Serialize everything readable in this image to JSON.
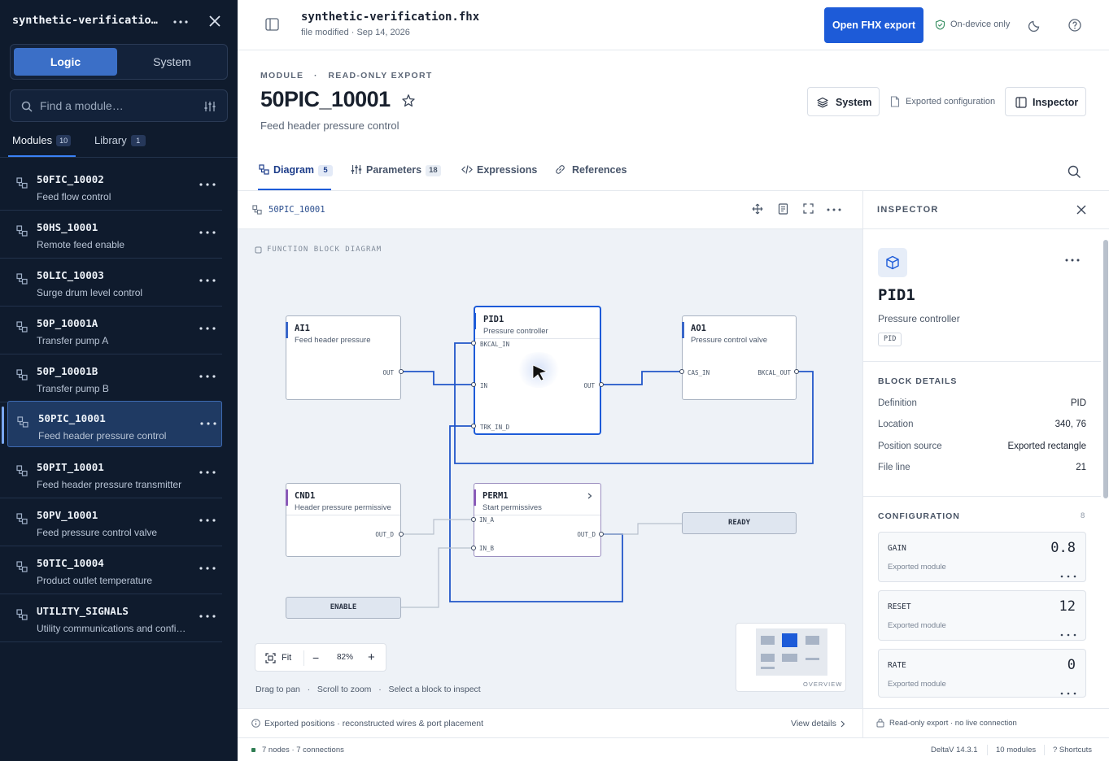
{
  "sidebar": {
    "title": "synthetic-verification.fhx",
    "segments": {
      "logic": "Logic",
      "system": "System"
    },
    "search_placeholder": "Find a module…",
    "tabs": {
      "modules": "Modules",
      "modules_count": "10",
      "library": "Library",
      "library_count": "1"
    },
    "modules": [
      {
        "name": "50FIC_10002",
        "desc": "Feed flow control"
      },
      {
        "name": "50HS_10001",
        "desc": "Remote feed enable"
      },
      {
        "name": "50LIC_10003",
        "desc": "Surge drum level control"
      },
      {
        "name": "50P_10001A",
        "desc": "Transfer pump A"
      },
      {
        "name": "50P_10001B",
        "desc": "Transfer pump B"
      },
      {
        "name": "50PIC_10001",
        "desc": "Feed header pressure control",
        "selected": true
      },
      {
        "name": "50PIT_10001",
        "desc": "Feed header pressure transmitter"
      },
      {
        "name": "50PV_10001",
        "desc": "Feed pressure control valve"
      },
      {
        "name": "50TIC_10004",
        "desc": "Product outlet temperature"
      },
      {
        "name": "UTILITY_SIGNALS",
        "desc": "Utility communications and configuration"
      }
    ]
  },
  "topbar": {
    "file": "synthetic-verification.fhx",
    "modified": "file modified · Sep 14, 2026",
    "primary": "Open FHX export",
    "on_device": "On-device only"
  },
  "header": {
    "kicker_a": "MODULE",
    "kicker_sep": "·",
    "kicker_b": "READ-ONLY EXPORT",
    "title": "50PIC_10001",
    "subtitle": "Feed header pressure control",
    "system_btn": "System",
    "exported": "Exported configuration",
    "inspector_btn": "Inspector",
    "tabs": [
      {
        "label": "Diagram",
        "count": "5"
      },
      {
        "label": "Parameters",
        "count": "18"
      },
      {
        "label": "Expressions"
      },
      {
        "label": "References"
      }
    ]
  },
  "canvas": {
    "breadcrumb": "50PIC_10001",
    "section_label": "FUNCTION BLOCK DIAGRAM",
    "blocks": {
      "ai1": {
        "name": "AI1",
        "desc": "Feed header pressure",
        "ports": {
          "out": "OUT"
        }
      },
      "pid1": {
        "name": "PID1",
        "desc": "Pressure controller",
        "ports": {
          "bkcal_in": "BKCAL_IN",
          "in": "IN",
          "out": "OUT",
          "trk_in_d": "TRK_IN_D"
        }
      },
      "ao1": {
        "name": "AO1",
        "desc": "Pressure control valve",
        "ports": {
          "cas_in": "CAS_IN",
          "bkcal_out": "BKCAL_OUT"
        }
      },
      "cnd1": {
        "name": "CND1",
        "desc": "Header pressure permissive",
        "ports": {
          "out_d": "OUT_D"
        }
      },
      "perm1": {
        "name": "PERM1",
        "desc": "Start permissives",
        "ports": {
          "in_a": "IN_A",
          "in_b": "IN_B",
          "out_d": "OUT_D"
        }
      }
    },
    "ready": "READY",
    "enable": "ENABLE",
    "zoom": {
      "fit": "Fit",
      "level": "82%",
      "minus": "−",
      "plus": "+"
    },
    "hints": {
      "a": "Drag to pan",
      "b": "Scroll to zoom",
      "c": "Select a block to inspect",
      "sep": "·"
    },
    "overview": "OVERVIEW",
    "footer": {
      "note": "Exported positions · reconstructed wires & port placement",
      "link": "View details"
    }
  },
  "inspector": {
    "title": "INSPECTOR",
    "block_name": "PID1",
    "block_desc": "Pressure controller",
    "tag": "PID",
    "details_title": "BLOCK DETAILS",
    "details": [
      {
        "k": "Definition",
        "v": "PID"
      },
      {
        "k": "Location",
        "v": "340, 76"
      },
      {
        "k": "Position source",
        "v": "Exported rectangle"
      },
      {
        "k": "File line",
        "v": "21"
      }
    ],
    "config_title": "CONFIGURATION",
    "config_count": "8",
    "config": [
      {
        "k": "GAIN",
        "v": "0.8",
        "s": "Exported module"
      },
      {
        "k": "RESET",
        "v": "12",
        "s": "Exported module"
      },
      {
        "k": "RATE",
        "v": "0",
        "s": "Exported module"
      }
    ],
    "footer": "Read-only export · no live connection"
  },
  "status": {
    "nodes": "7 nodes · 7 connections",
    "version": "DeltaV 14.3.1",
    "modules": "10 modules",
    "shortcuts": "? Shortcuts"
  },
  "colors": {
    "accent": "#1d5bd8",
    "sidebar": "#0f1b2d",
    "wire": "#2257c9",
    "canvas": "#eef2f7"
  }
}
